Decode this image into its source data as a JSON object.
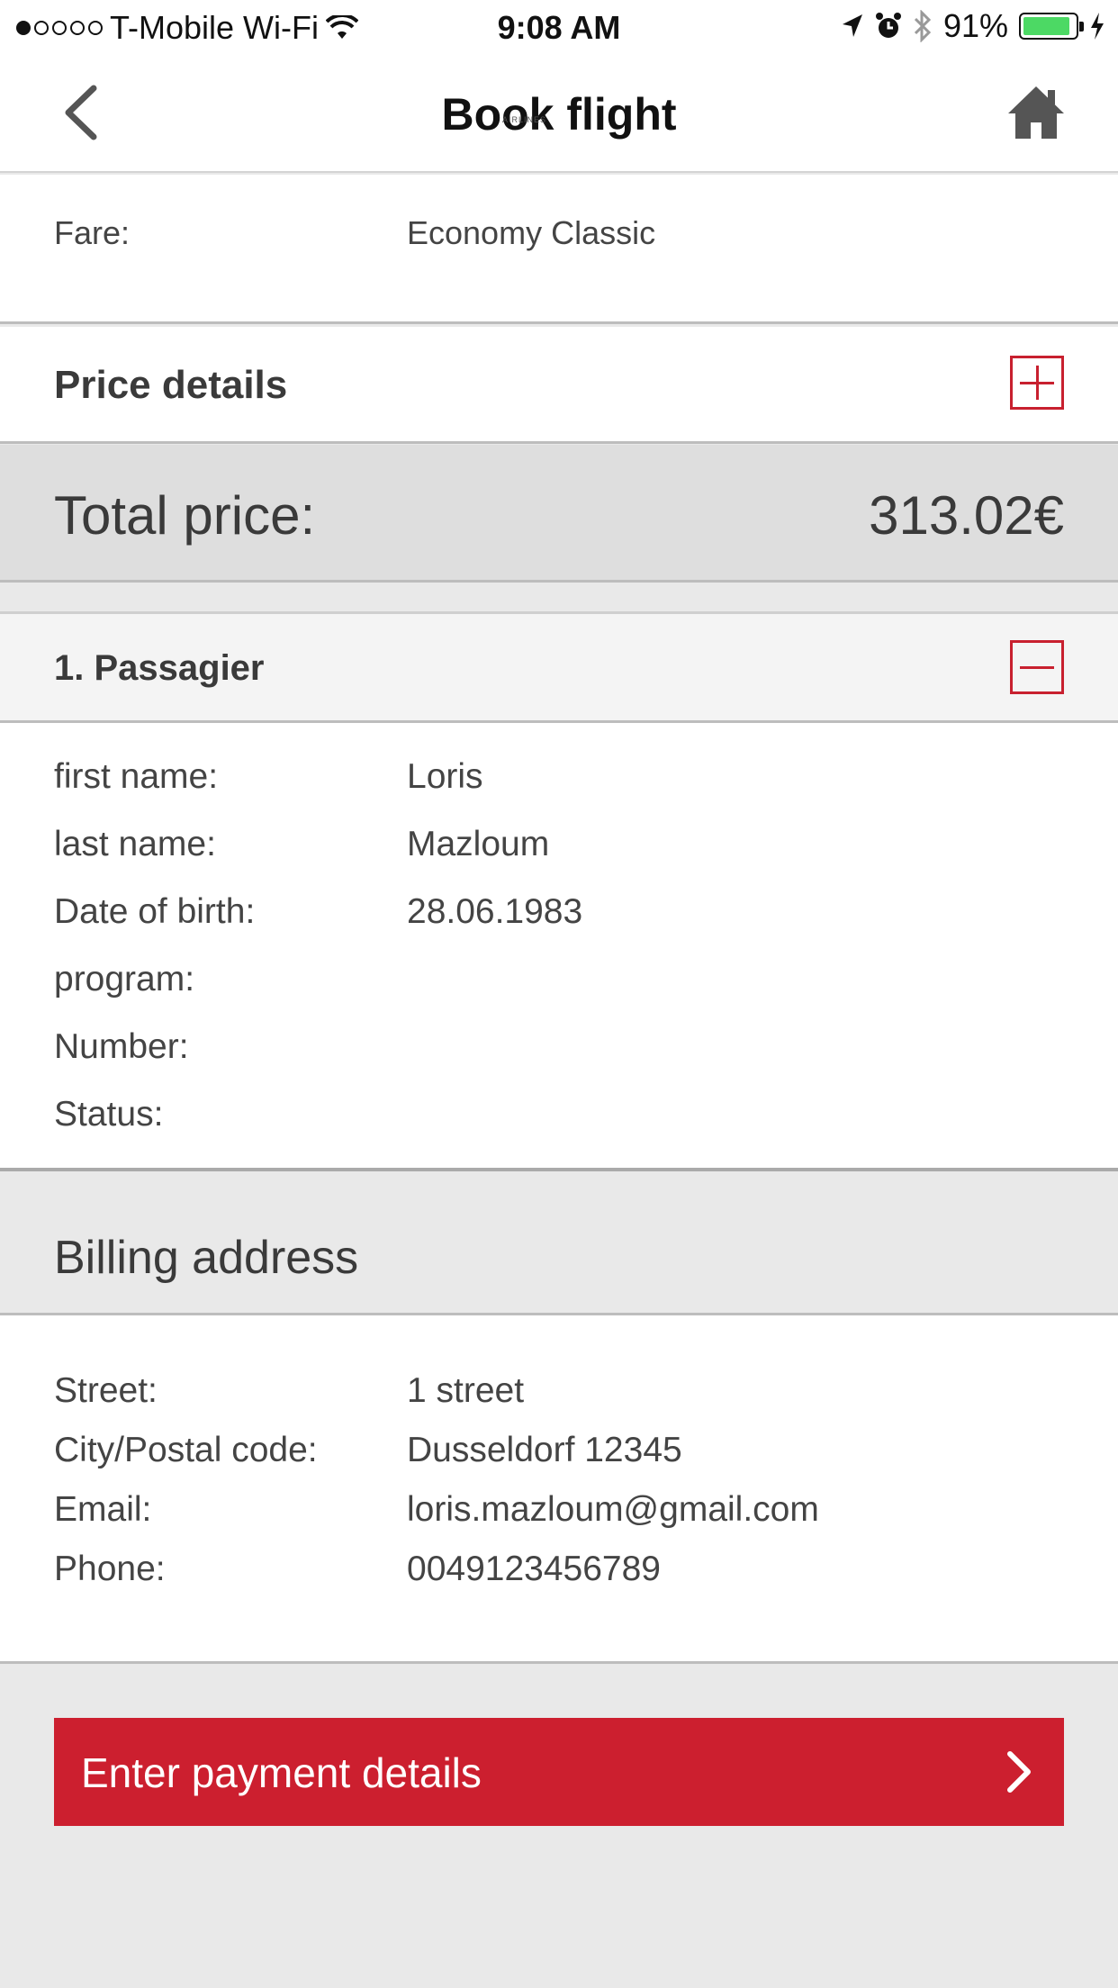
{
  "status_bar": {
    "carrier": "T-Mobile Wi-Fi",
    "time": "9:08 AM",
    "battery": "91%",
    "battery_level": 0.91,
    "signal_bars_filled": 1,
    "signal_bars_total": 5,
    "icons": [
      "wifi-icon",
      "location-arrow-icon",
      "alarm-icon",
      "bluetooth-icon",
      "battery-icon",
      "charging-bolt-icon"
    ]
  },
  "nav": {
    "title": "Book flight",
    "back_icon": "chevron-left-icon",
    "home_icon": "home-icon"
  },
  "logo_remnant": "AIRLINES",
  "fare": {
    "label": "Fare:",
    "value": "Economy Classic"
  },
  "price_details": {
    "label": "Price details",
    "toggle_icon": "plus-box-icon"
  },
  "total": {
    "label": "Total price:",
    "value": "313.02€"
  },
  "passenger": {
    "title": "1. Passagier",
    "toggle_icon": "minus-box-icon",
    "fields": [
      {
        "label": "first name:",
        "value": "Loris"
      },
      {
        "label": "last name:",
        "value": "Mazloum"
      },
      {
        "label": "Date of birth:",
        "value": "28.06.1983"
      },
      {
        "label": "program:",
        "value": ""
      },
      {
        "label": "Number:",
        "value": ""
      },
      {
        "label": "Status:",
        "value": ""
      }
    ]
  },
  "billing": {
    "title": "Billing address",
    "fields": [
      {
        "label": "Street:",
        "value": "1 street"
      },
      {
        "label": "City/Postal code:",
        "value": "Dusseldorf 12345"
      },
      {
        "label": "Email:",
        "value": "loris.mazloum@gmail.com"
      },
      {
        "label": "Phone:",
        "value": "0049123456789"
      }
    ]
  },
  "cta": {
    "label": "Enter payment details",
    "icon": "chevron-right-icon"
  },
  "colors": {
    "accent": "#cc1f2f",
    "battery_green": "#4cd964",
    "total_bg": "#dedede",
    "page_bg": "#e9e9e9"
  }
}
